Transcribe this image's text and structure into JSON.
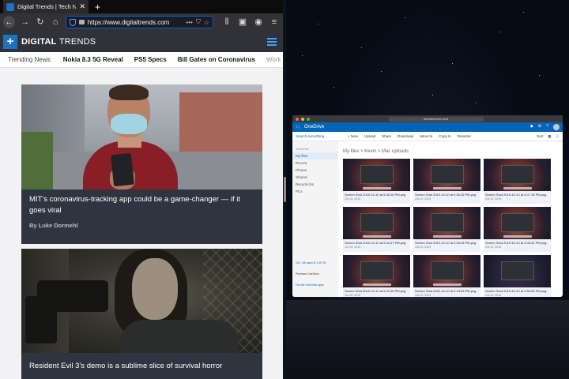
{
  "firefox": {
    "tab": {
      "title": "Digital Trends | Tech News, Reviews"
    },
    "url": "https://www.digitaltrends.com",
    "url_more": "•••"
  },
  "site": {
    "logo_mark": "+",
    "logo_bold": "DIGITAL",
    "logo_light": "TRENDS",
    "trending_label": "Trending News:",
    "trending": [
      "Nokia 8.3 5G Reveal",
      "PS5 Specs",
      "Bill Gates on Coronavirus",
      "Work Fr"
    ],
    "articles": [
      {
        "title": "MIT’s coronavirus-tracking app could be a game-changer — if it goes viral",
        "byline": "By Luke Dormehl"
      },
      {
        "title": "Resident Evil 3’s demo is a sublime slice of survival horror",
        "byline": ""
      }
    ]
  },
  "onedrive": {
    "address": "onedrive.live.com",
    "brand": "OneDrive",
    "search_placeholder": "Search everything",
    "commands": [
      "+ New",
      "Upload",
      "Share",
      "Download",
      "Move to",
      "Copy to",
      "Rename"
    ],
    "sort": "Sort",
    "sidebar_header": "OneDrive",
    "sidebar_items": [
      "My files",
      "Recent",
      "Photos",
      "Shared",
      "Recycle bin",
      "PCs"
    ],
    "storage": "15.1 GB used of 1.05 TB",
    "premium": "Premium OneDrive",
    "get_apps": "Get the OneDrive apps",
    "breadcrumb": "My files  >  Kevin  >  Mac uploads",
    "files": [
      {
        "name": "Screen Shot 2019-10-10 at 9.08.16 PM.png",
        "date": "Oct 10, 2019"
      },
      {
        "name": "Screen Shot 2019-10-10 at 9.06.26 PM.png",
        "date": "Oct 10, 2019"
      },
      {
        "name": "Screen Shot 2019-10-10 at 9.07.18 PM.png",
        "date": "Oct 10, 2019"
      },
      {
        "name": "Screen Shot 2019-10-10 at 9.04.07 PM.png",
        "date": "Oct 10, 2019"
      },
      {
        "name": "Screen Shot 2019-10-10 at 9.05.28 PM.png",
        "date": "Oct 10, 2019"
      },
      {
        "name": "Screen Shot 2019-10-10 at 9.05.42 PM.png",
        "date": "Oct 10, 2019"
      },
      {
        "name": "Screen Shot 2019-10-10 at 9.22.06 PM.png",
        "date": "Oct 10, 2019"
      },
      {
        "name": "Screen Shot 2019-10-10 at 9.23.05 PM.png",
        "date": "Oct 10, 2019"
      },
      {
        "name": "Screen Shot 2019-10-10 at 3.58.53 PM.png",
        "date": "Oct 10, 2019"
      }
    ]
  },
  "colors": {
    "firefox_toolbar": "#323234",
    "url_focus": "#0060df",
    "dt_header": "#2f3339",
    "dt_blue": "#1e73be",
    "card_bg": "#2f3540",
    "onedrive_blue": "#0364b8"
  }
}
